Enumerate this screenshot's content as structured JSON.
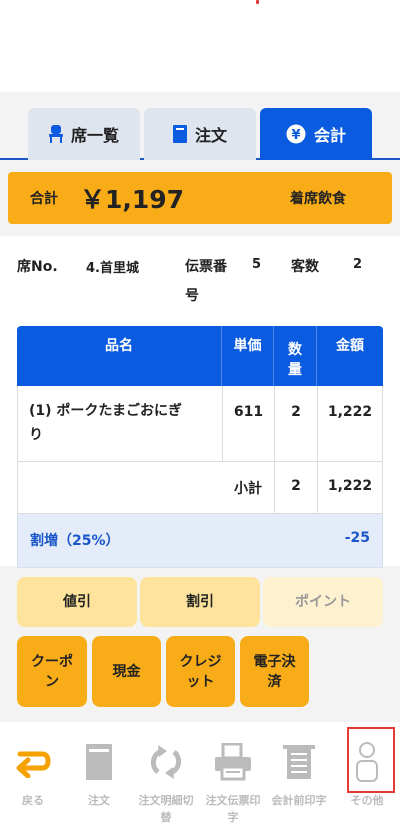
{
  "tabs": [
    {
      "label": "席一覧",
      "icon": "chair-icon"
    },
    {
      "label": "注文",
      "icon": "book-icon"
    },
    {
      "label": "会計",
      "icon": "yen-coin-icon"
    }
  ],
  "total": {
    "label": "合計",
    "amount": "￥1,197",
    "mode": "着席飲食"
  },
  "info": {
    "seat_label": "席No.",
    "seat_value": "4.首里城",
    "slip_label_line1": "伝票番",
    "slip_label_line2": "号",
    "slip_value": "5",
    "guests_label": "客数",
    "guests_value": "2"
  },
  "table": {
    "headers": {
      "name": "品名",
      "price": "単価",
      "qty_line1": "数",
      "qty_line2": "量",
      "amount": "金額"
    },
    "row": {
      "name_line1": "(1) ポークたまごおにぎ",
      "name_line2": "り",
      "price": "611",
      "qty": "2",
      "amount": "1,222"
    },
    "subtotal": {
      "label": "小計",
      "qty": "2",
      "amount": "1,222"
    },
    "surcharge": {
      "label": "割増（25%）",
      "amount": "-25"
    }
  },
  "discount_buttons": {
    "value_discount": "値引",
    "rate_discount": "割引",
    "points": "ポイント"
  },
  "payment_buttons": {
    "coupon_line1": "クーポ",
    "coupon_line2": "ン",
    "cash": "現金",
    "credit_line1": "クレジ",
    "credit_line2": "ット",
    "emoney_line1": "電子決",
    "emoney_line2": "済"
  },
  "bottom_nav": {
    "back": "戻る",
    "order": "注文",
    "detail_toggle_line1": "注文明細切",
    "detail_toggle_line2": "替",
    "slip_print_line1": "注文伝票印",
    "slip_print_line2": "字",
    "pre_check_print": "会計前印字",
    "others": "その他"
  },
  "colors": {
    "accent_blue": "#0a5be0",
    "accent_orange": "#f8ac17",
    "highlight_red": "#e53935"
  }
}
